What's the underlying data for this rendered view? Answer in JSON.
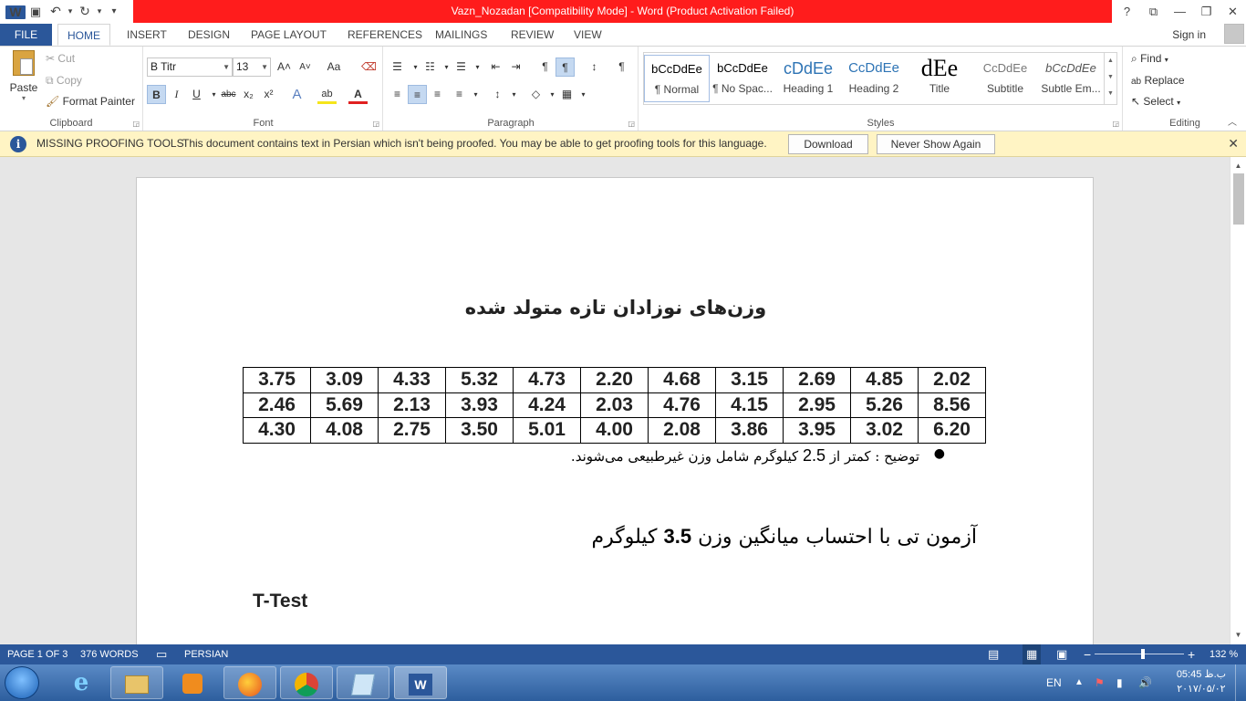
{
  "window": {
    "title": "Vazn_Nozadan [Compatibility Mode] -  Word (Product Activation Failed)",
    "help": "?",
    "ribbon_display": "⧉",
    "minimize": "—",
    "restore": "❐",
    "close": "✕"
  },
  "qat": {
    "save": "💾",
    "undo": "↶",
    "redo": "↻",
    "customize": "▾",
    "logo": "W"
  },
  "tabs": [
    "FILE",
    "HOME",
    "INSERT",
    "DESIGN",
    "PAGE LAYOUT",
    "REFERENCES",
    "MAILINGS",
    "REVIEW",
    "VIEW"
  ],
  "signin": "Sign in",
  "clipboard": {
    "paste": "Paste",
    "cut": "Cut",
    "copy": "Copy",
    "format_painter": "Format Painter",
    "label": "Clipboard"
  },
  "font": {
    "name": "B Titr",
    "size": "13",
    "grow": "A˄",
    "shrink": "A˅",
    "case": "Aa",
    "clear": "⌫",
    "bold": "B",
    "italic": "I",
    "underline": "U",
    "strike": "abc",
    "sub": "x₂",
    "sup": "x²",
    "effects": "A",
    "highlight": "ab",
    "color": "A",
    "label": "Font"
  },
  "paragraph": {
    "bullets": "☰",
    "numbering": "☷",
    "multilevel": "☰",
    "decrease_indent": "⇤",
    "increase_indent": "⇥",
    "ltr": "¶",
    "rtl": "¶",
    "sort": "↕",
    "show": "¶",
    "align_left": "≡",
    "center": "≡",
    "align_right": "≡",
    "justify": "≡",
    "spacing": "↕",
    "shading": "◇",
    "borders": "▦",
    "label": "Paragraph"
  },
  "styles": {
    "items": [
      {
        "preview": "bCcDdEe",
        "name": "¶ Normal"
      },
      {
        "preview": "bCcDdEe",
        "name": "¶ No Spac..."
      },
      {
        "preview": "cDdEe",
        "name": "Heading 1"
      },
      {
        "preview": "CcDdEe",
        "name": "Heading 2"
      },
      {
        "preview": "dEe",
        "name": "Title"
      },
      {
        "preview": "CcDdEe",
        "name": "Subtitle"
      },
      {
        "preview": "bCcDdEe",
        "name": "Subtle Em..."
      }
    ],
    "label": "Styles"
  },
  "editing": {
    "find": "Find",
    "replace": "Replace",
    "select": "Select",
    "label": "Editing"
  },
  "message_bar": {
    "title": "MISSING PROOFING TOOLS",
    "text": "This document contains text in Persian which isn't being proofed. You may be able to get proofing tools for this language.",
    "download": "Download",
    "never": "Never Show Again"
  },
  "document": {
    "title": "وزن‌های نوزادان تازه متولد شده",
    "table": [
      [
        "3.75",
        "3.09",
        "4.33",
        "5.32",
        "4.73",
        "2.20",
        "4.68",
        "3.15",
        "2.69",
        "4.85",
        "2.02"
      ],
      [
        "2.46",
        "5.69",
        "2.13",
        "3.93",
        "4.24",
        "2.03",
        "4.76",
        "4.15",
        "2.95",
        "5.26",
        "8.56"
      ],
      [
        "4.30",
        "4.08",
        "2.75",
        "3.50",
        "5.01",
        "4.00",
        "2.08",
        "3.86",
        "3.95",
        "3.02",
        "6.20"
      ]
    ],
    "note_before": "توضیح : کمتر از ",
    "note_number": "2.5",
    "note_after": " کیلوگرم شامل وزن غیرطبیعی می‌شوند.",
    "heading_before": "آزمون تی با احتساب میانگین وزن ",
    "heading_number": "3.5",
    "heading_after": " کیلوگرم",
    "ttest": "T-Test"
  },
  "status": {
    "page": "PAGE 1 OF 3",
    "words": "376 WORDS",
    "language": "PERSIAN",
    "zoom": "132 %",
    "zoom_value": 132
  },
  "taskbar": {
    "lang": "EN",
    "time": "05:45 ب.ظ",
    "date": "۲۰۱۷/۰۵/۰۲"
  }
}
